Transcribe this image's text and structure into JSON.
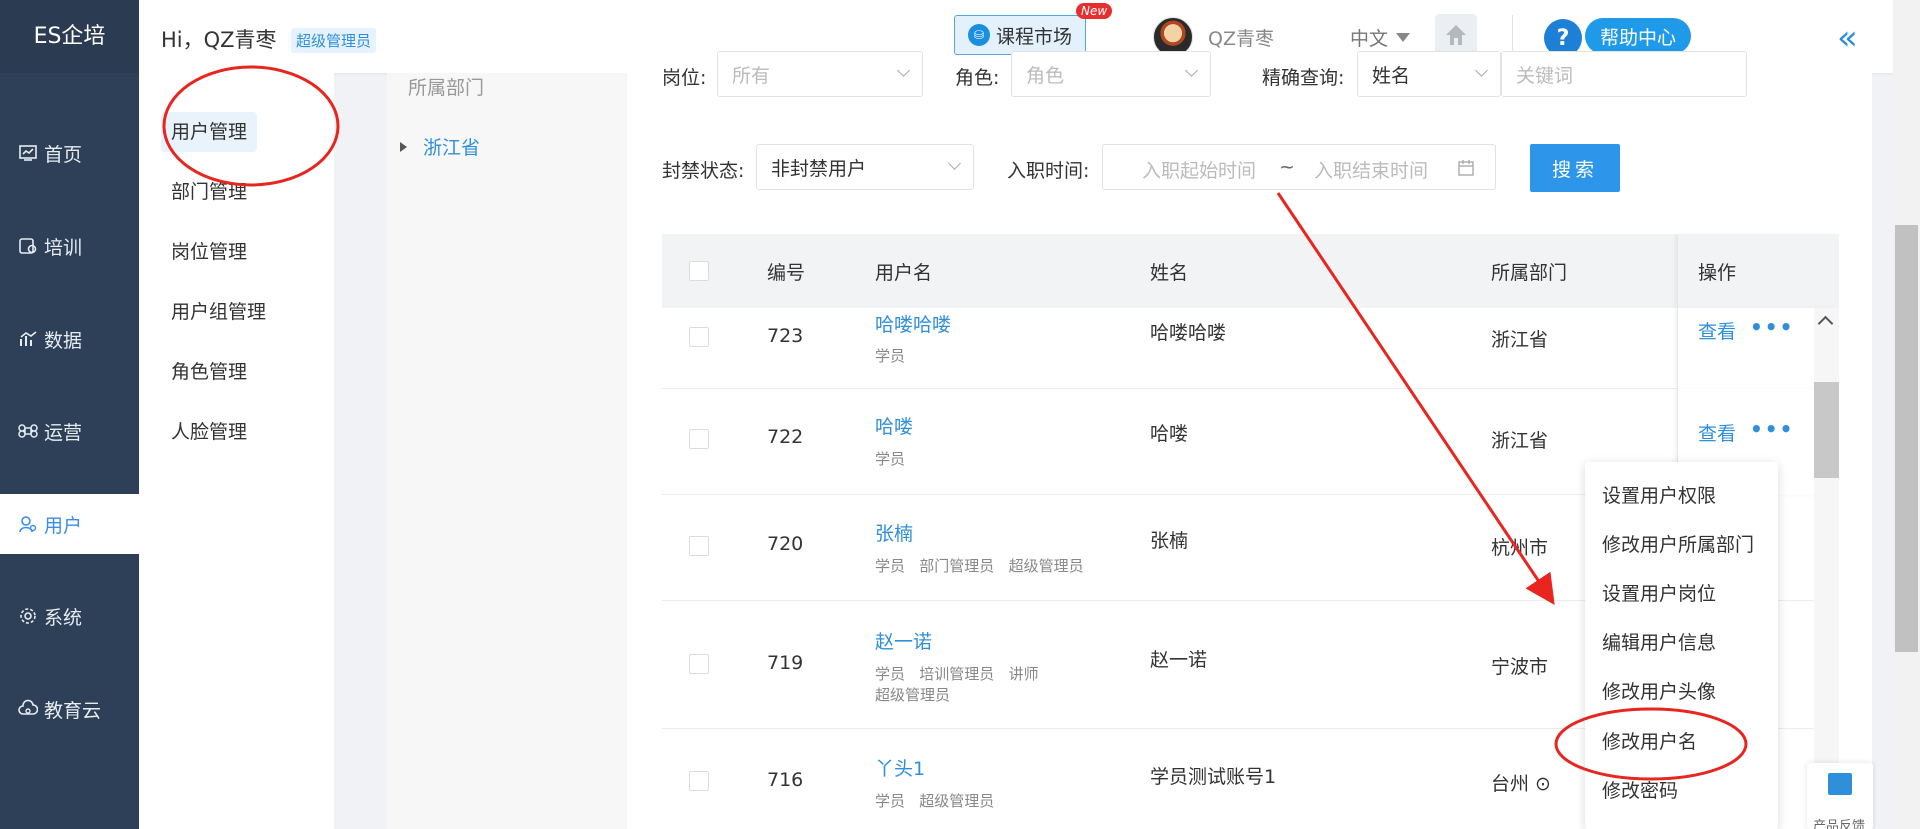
{
  "brand": "ES企培",
  "header": {
    "greeting": "Hi，QZ青枣",
    "role_badge": "超级管理员",
    "course_market": "课程市场",
    "new_badge": "New",
    "username": "QZ青枣",
    "language": "中文",
    "help_center": "帮助中心",
    "collapse": "«"
  },
  "nav": [
    {
      "label": "首页",
      "icon": "dashboard-icon"
    },
    {
      "label": "培训",
      "icon": "training-icon"
    },
    {
      "label": "数据",
      "icon": "chart-icon"
    },
    {
      "label": "运营",
      "icon": "command-icon"
    },
    {
      "label": "用户",
      "icon": "user-icon",
      "active": true
    },
    {
      "label": "系统",
      "icon": "gear-icon"
    },
    {
      "label": "教育云",
      "icon": "cloud-icon"
    }
  ],
  "submenu": [
    "用户管理",
    "部门管理",
    "岗位管理",
    "用户组管理",
    "角色管理",
    "人脸管理"
  ],
  "dept": {
    "title": "所属部门",
    "root": "浙江省"
  },
  "filters": {
    "position_label": "岗位:",
    "position_value": "所有",
    "role_label": "角色:",
    "role_value": "角色",
    "exact_label": "精确查询:",
    "exact_value": "姓名",
    "keyword_placeholder": "关键词",
    "ban_label": "封禁状态:",
    "ban_value": "非封禁用户",
    "join_label": "入职时间:",
    "join_start": "入职起始时间",
    "join_sep": "~",
    "join_end": "入职结束时间",
    "search": "搜索"
  },
  "table": {
    "headers": [
      "编号",
      "用户名",
      "姓名",
      "所属部门",
      "操作"
    ],
    "rows": [
      {
        "id": "723",
        "username": "哈喽哈喽",
        "tags": "学员",
        "name": "哈喽哈喽",
        "dept": "浙江省"
      },
      {
        "id": "722",
        "username": "哈喽",
        "tags": "学员",
        "name": "哈喽",
        "dept": "浙江省"
      },
      {
        "id": "720",
        "username": "张楠",
        "tags": "学员   部门管理员   超级管理员",
        "name": "张楠",
        "dept": "杭州市"
      },
      {
        "id": "719",
        "username": "赵一诺",
        "tags": "学员   培训管理员   讲师",
        "tags2": "超级管理员",
        "name": "赵一诺",
        "dept": "宁波市"
      },
      {
        "id": "716",
        "username": "丫头1",
        "tags": "学员   超级管理员",
        "name": "学员测试账号1",
        "dept": "台州 ⊙"
      }
    ],
    "view": "查看",
    "more": "•••"
  },
  "dropdown": [
    "设置用户权限",
    "修改用户所属部门",
    "设置用户岗位",
    "编辑用户信息",
    "修改用户头像",
    "修改用户名",
    "修改密码"
  ],
  "feedback": "产品反馈",
  "colors": {
    "nav_bg": "#2e4057",
    "accent": "#2f8fd8",
    "annotation": "#e8251f"
  }
}
